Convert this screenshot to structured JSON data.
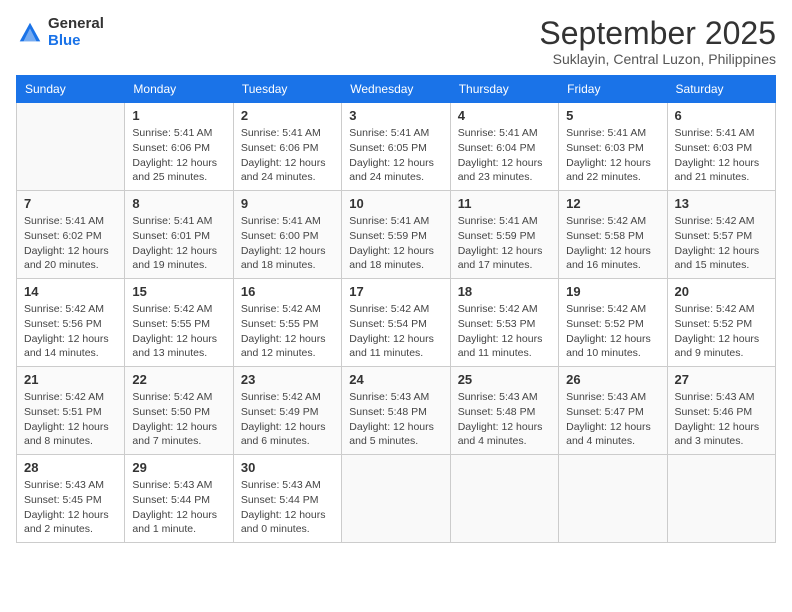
{
  "logo": {
    "general": "General",
    "blue": "Blue"
  },
  "title": "September 2025",
  "location": "Suklayin, Central Luzon, Philippines",
  "weekdays": [
    "Sunday",
    "Monday",
    "Tuesday",
    "Wednesday",
    "Thursday",
    "Friday",
    "Saturday"
  ],
  "weeks": [
    [
      {
        "day": "",
        "sunrise": "",
        "sunset": "",
        "daylight": ""
      },
      {
        "day": "1",
        "sunrise": "Sunrise: 5:41 AM",
        "sunset": "Sunset: 6:06 PM",
        "daylight": "Daylight: 12 hours and 25 minutes."
      },
      {
        "day": "2",
        "sunrise": "Sunrise: 5:41 AM",
        "sunset": "Sunset: 6:06 PM",
        "daylight": "Daylight: 12 hours and 24 minutes."
      },
      {
        "day": "3",
        "sunrise": "Sunrise: 5:41 AM",
        "sunset": "Sunset: 6:05 PM",
        "daylight": "Daylight: 12 hours and 24 minutes."
      },
      {
        "day": "4",
        "sunrise": "Sunrise: 5:41 AM",
        "sunset": "Sunset: 6:04 PM",
        "daylight": "Daylight: 12 hours and 23 minutes."
      },
      {
        "day": "5",
        "sunrise": "Sunrise: 5:41 AM",
        "sunset": "Sunset: 6:03 PM",
        "daylight": "Daylight: 12 hours and 22 minutes."
      },
      {
        "day": "6",
        "sunrise": "Sunrise: 5:41 AM",
        "sunset": "Sunset: 6:03 PM",
        "daylight": "Daylight: 12 hours and 21 minutes."
      }
    ],
    [
      {
        "day": "7",
        "sunrise": "Sunrise: 5:41 AM",
        "sunset": "Sunset: 6:02 PM",
        "daylight": "Daylight: 12 hours and 20 minutes."
      },
      {
        "day": "8",
        "sunrise": "Sunrise: 5:41 AM",
        "sunset": "Sunset: 6:01 PM",
        "daylight": "Daylight: 12 hours and 19 minutes."
      },
      {
        "day": "9",
        "sunrise": "Sunrise: 5:41 AM",
        "sunset": "Sunset: 6:00 PM",
        "daylight": "Daylight: 12 hours and 18 minutes."
      },
      {
        "day": "10",
        "sunrise": "Sunrise: 5:41 AM",
        "sunset": "Sunset: 5:59 PM",
        "daylight": "Daylight: 12 hours and 18 minutes."
      },
      {
        "day": "11",
        "sunrise": "Sunrise: 5:41 AM",
        "sunset": "Sunset: 5:59 PM",
        "daylight": "Daylight: 12 hours and 17 minutes."
      },
      {
        "day": "12",
        "sunrise": "Sunrise: 5:42 AM",
        "sunset": "Sunset: 5:58 PM",
        "daylight": "Daylight: 12 hours and 16 minutes."
      },
      {
        "day": "13",
        "sunrise": "Sunrise: 5:42 AM",
        "sunset": "Sunset: 5:57 PM",
        "daylight": "Daylight: 12 hours and 15 minutes."
      }
    ],
    [
      {
        "day": "14",
        "sunrise": "Sunrise: 5:42 AM",
        "sunset": "Sunset: 5:56 PM",
        "daylight": "Daylight: 12 hours and 14 minutes."
      },
      {
        "day": "15",
        "sunrise": "Sunrise: 5:42 AM",
        "sunset": "Sunset: 5:55 PM",
        "daylight": "Daylight: 12 hours and 13 minutes."
      },
      {
        "day": "16",
        "sunrise": "Sunrise: 5:42 AM",
        "sunset": "Sunset: 5:55 PM",
        "daylight": "Daylight: 12 hours and 12 minutes."
      },
      {
        "day": "17",
        "sunrise": "Sunrise: 5:42 AM",
        "sunset": "Sunset: 5:54 PM",
        "daylight": "Daylight: 12 hours and 11 minutes."
      },
      {
        "day": "18",
        "sunrise": "Sunrise: 5:42 AM",
        "sunset": "Sunset: 5:53 PM",
        "daylight": "Daylight: 12 hours and 11 minutes."
      },
      {
        "day": "19",
        "sunrise": "Sunrise: 5:42 AM",
        "sunset": "Sunset: 5:52 PM",
        "daylight": "Daylight: 12 hours and 10 minutes."
      },
      {
        "day": "20",
        "sunrise": "Sunrise: 5:42 AM",
        "sunset": "Sunset: 5:52 PM",
        "daylight": "Daylight: 12 hours and 9 minutes."
      }
    ],
    [
      {
        "day": "21",
        "sunrise": "Sunrise: 5:42 AM",
        "sunset": "Sunset: 5:51 PM",
        "daylight": "Daylight: 12 hours and 8 minutes."
      },
      {
        "day": "22",
        "sunrise": "Sunrise: 5:42 AM",
        "sunset": "Sunset: 5:50 PM",
        "daylight": "Daylight: 12 hours and 7 minutes."
      },
      {
        "day": "23",
        "sunrise": "Sunrise: 5:42 AM",
        "sunset": "Sunset: 5:49 PM",
        "daylight": "Daylight: 12 hours and 6 minutes."
      },
      {
        "day": "24",
        "sunrise": "Sunrise: 5:43 AM",
        "sunset": "Sunset: 5:48 PM",
        "daylight": "Daylight: 12 hours and 5 minutes."
      },
      {
        "day": "25",
        "sunrise": "Sunrise: 5:43 AM",
        "sunset": "Sunset: 5:48 PM",
        "daylight": "Daylight: 12 hours and 4 minutes."
      },
      {
        "day": "26",
        "sunrise": "Sunrise: 5:43 AM",
        "sunset": "Sunset: 5:47 PM",
        "daylight": "Daylight: 12 hours and 4 minutes."
      },
      {
        "day": "27",
        "sunrise": "Sunrise: 5:43 AM",
        "sunset": "Sunset: 5:46 PM",
        "daylight": "Daylight: 12 hours and 3 minutes."
      }
    ],
    [
      {
        "day": "28",
        "sunrise": "Sunrise: 5:43 AM",
        "sunset": "Sunset: 5:45 PM",
        "daylight": "Daylight: 12 hours and 2 minutes."
      },
      {
        "day": "29",
        "sunrise": "Sunrise: 5:43 AM",
        "sunset": "Sunset: 5:44 PM",
        "daylight": "Daylight: 12 hours and 1 minute."
      },
      {
        "day": "30",
        "sunrise": "Sunrise: 5:43 AM",
        "sunset": "Sunset: 5:44 PM",
        "daylight": "Daylight: 12 hours and 0 minutes."
      },
      {
        "day": "",
        "sunrise": "",
        "sunset": "",
        "daylight": ""
      },
      {
        "day": "",
        "sunrise": "",
        "sunset": "",
        "daylight": ""
      },
      {
        "day": "",
        "sunrise": "",
        "sunset": "",
        "daylight": ""
      },
      {
        "day": "",
        "sunrise": "",
        "sunset": "",
        "daylight": ""
      }
    ]
  ]
}
